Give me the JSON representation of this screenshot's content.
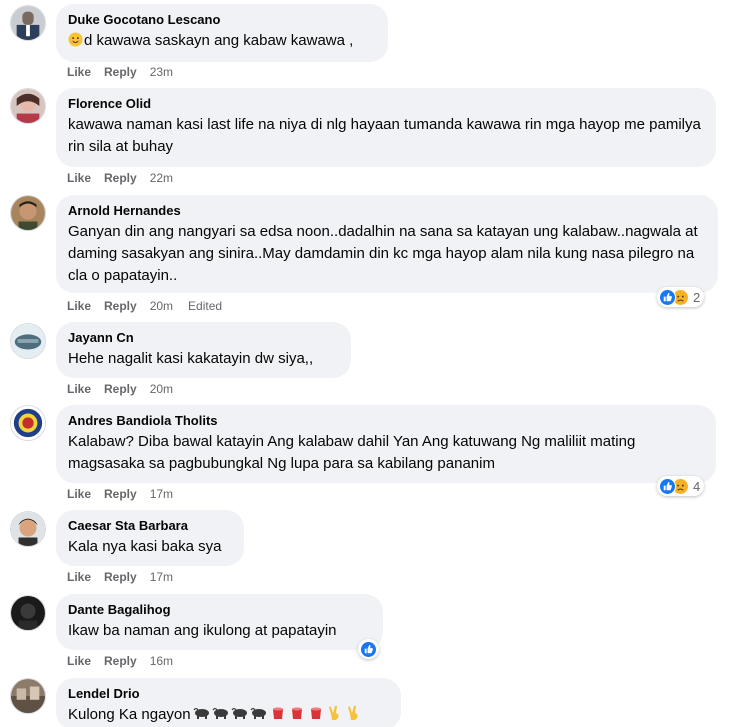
{
  "labels": {
    "like": "Like",
    "reply": "Reply",
    "edited": "Edited"
  },
  "colors": {
    "bubble": "#f0f2f5",
    "action_text": "#65676b",
    "like_blue": "#1877f2",
    "sad_yellow": "#f7b125"
  },
  "comments": [
    {
      "author": "Duke Gocotano Lescano",
      "text": "d kawawa saskayn ang kabaw kawawa ,",
      "leading_emoji": "smiling-face",
      "time": "23m"
    },
    {
      "author": "Florence Olid",
      "text": "kawawa naman kasi last life na niya di nlg hayaan tumanda kawawa rin mga hayop me pamilya rin sila at buhay",
      "time": "22m"
    },
    {
      "author": "Arnold Hernandes",
      "text": "Ganyan din ang nangyari sa edsa noon..dadalhin na sana sa katayan ung kalabaw..nagwala at daming sasakyan ang sinira..May damdamin din kc mga hayop alam nila kung nasa pilegro na cla o papatayin..",
      "time": "20m",
      "edited": true,
      "reactions": {
        "icons": [
          "like",
          "sad"
        ],
        "count": "2"
      }
    },
    {
      "author": "Jayann Cn",
      "text": "Hehe nagalit kasi kakatayin dw siya,,",
      "time": "20m"
    },
    {
      "author": "Andres Bandiola Tholits",
      "text": "Kalabaw? Diba bawal katayin Ang kalabaw dahil Yan Ang katuwang Ng maliliit mating magsasaka sa pagbubungkal Ng lupa para sa kabilang pananim",
      "time": "17m",
      "reactions": {
        "icons": [
          "like",
          "sad"
        ],
        "count": "4"
      }
    },
    {
      "author": "Caesar Sta Barbara",
      "text": "Kala nya kasi baka sya",
      "time": "17m"
    },
    {
      "author": "Dante Bagalihog",
      "text": "Ikaw ba naman ang ikulong at papatayin",
      "time": "16m",
      "reactions": {
        "icons": [
          "like"
        ]
      }
    },
    {
      "author": "Lendel Drio",
      "text": "Kulong Ka ngayon",
      "trailing_emojis": [
        "water-buffalo",
        "water-buffalo",
        "water-buffalo",
        "water-buffalo",
        "meat",
        "meat",
        "meat",
        "victory-hand",
        "victory-hand"
      ]
    }
  ]
}
